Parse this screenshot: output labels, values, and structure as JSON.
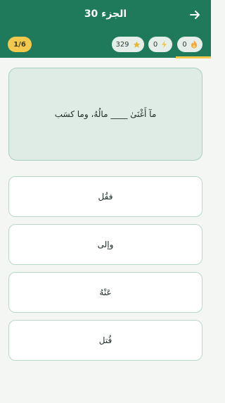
{
  "header": {
    "title": "الجزء 30"
  },
  "stats": {
    "progress": "1/6",
    "stars": "329",
    "bolts": "0",
    "streak": "0"
  },
  "question": {
    "text": "مآ أَغْنَىٰ ____ مالُهُ، وما كسَب"
  },
  "options": [
    {
      "label": "فقُل"
    },
    {
      "label": "وإلى"
    },
    {
      "label": "عَنْهُ"
    },
    {
      "label": "قُتل"
    }
  ],
  "colors": {
    "header": "#1f7a5c",
    "accent": "#f2c94c",
    "card": "#dfece6"
  },
  "icons": {
    "back": "arrow-right-icon",
    "stars": "star-icon",
    "bolts": "lightning-icon",
    "streak": "fire-icon"
  }
}
